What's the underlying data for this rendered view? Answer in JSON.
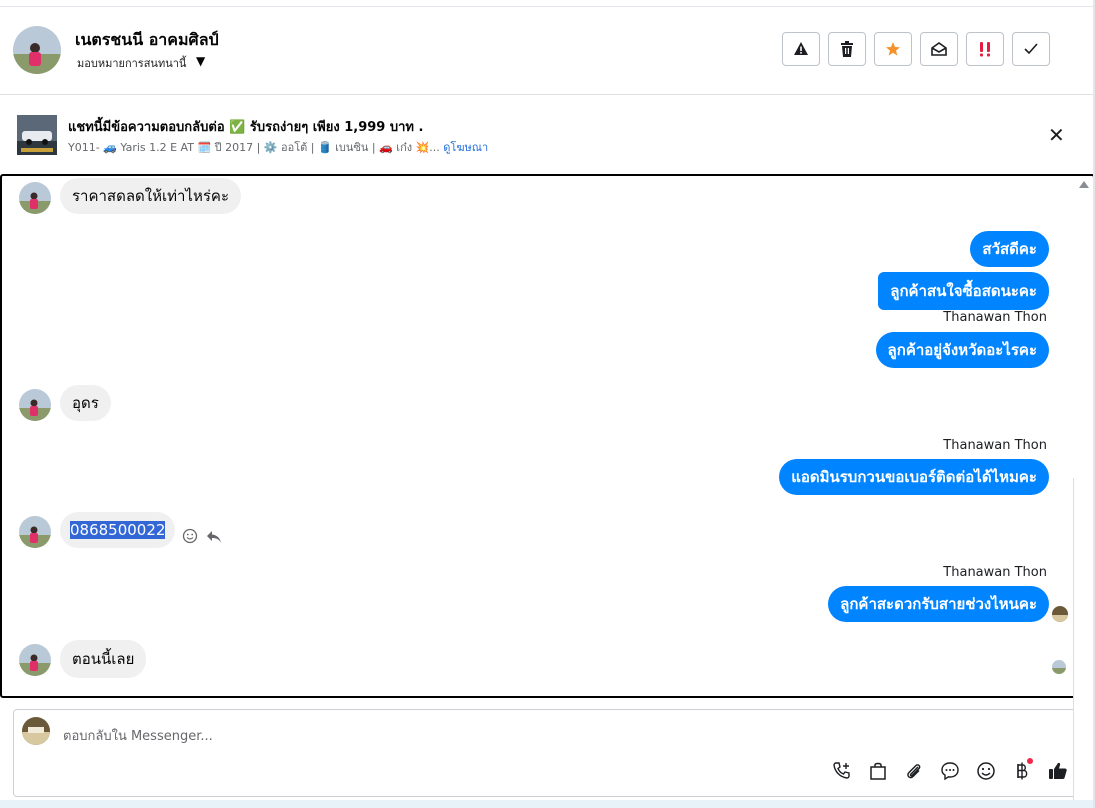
{
  "header": {
    "name": "เนตรชนนี อาคมศิลป์",
    "assign_label": "มอบหมายการสนทนานี้"
  },
  "actions": [
    {
      "name": "spam-icon"
    },
    {
      "name": "trash-icon"
    },
    {
      "name": "star-icon",
      "color": "#f5922b"
    },
    {
      "name": "mark-unread-icon"
    },
    {
      "name": "follow-up-icon",
      "color": "#e41e3f"
    },
    {
      "name": "done-icon"
    }
  ],
  "ad": {
    "title": "แชทนี้มีข้อความตอบกลับต่อ ✅ รับรถง่ายๆ เพียง 1,999 บาท .",
    "subtitle": "Y011- 🚙 Yaris 1.2 E AT 🗓️ ปี 2017 | ⚙️ ออโต้ | 🛢️ เบนซิน | 🚗 เก๋ง 💥...",
    "link": "ดูโฆษณา"
  },
  "messages": [
    {
      "dir": "in",
      "text": "ราคาสดลดให้เท่าไหร่คะ"
    },
    {
      "dir": "out",
      "text": "สวัสดีคะ"
    },
    {
      "dir": "out",
      "text": "ลูกค้าสนใจซื้อสดนะคะ"
    },
    {
      "dir": "out",
      "sender": "Thanawan Thon",
      "text": "ลูกค้าอยู่จังหวัดอะไรคะ"
    },
    {
      "dir": "in",
      "text": "อุดร"
    },
    {
      "dir": "out",
      "sender": "Thanawan Thon",
      "text": "แอดมินรบกวนขอเบอร์ติดต่อได้ไหมคะ"
    },
    {
      "dir": "in",
      "text": "0868500022"
    },
    {
      "dir": "out",
      "sender": "Thanawan Thon",
      "text": "ลูกค้าสะดวกรับสายช่วงไหนคะ"
    },
    {
      "dir": "in",
      "text": "ตอนนี้เลย"
    }
  ],
  "composer": {
    "placeholder": "ตอบกลับใน Messenger...",
    "tools": [
      "phone-plus-icon",
      "bag-icon",
      "paperclip-icon",
      "saved-reply-icon",
      "emoji-icon",
      "baht-icon",
      "thumbs-up-icon"
    ]
  },
  "colors": {
    "accent": "#0084ff",
    "incoming_bubble": "#f0f0f0",
    "link": "#216fdb"
  }
}
